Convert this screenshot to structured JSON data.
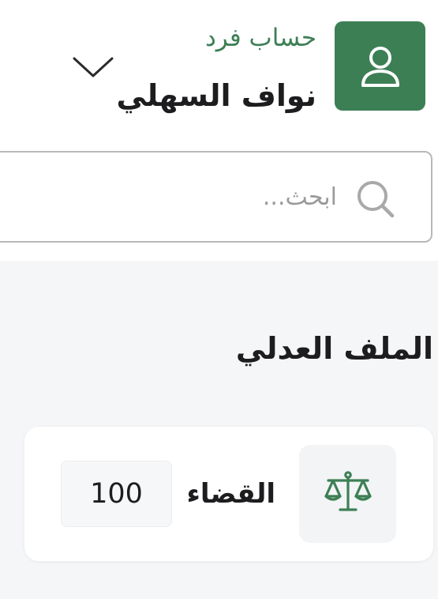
{
  "colors": {
    "accent": "#3d7f55",
    "text_primary": "#1d1d1f",
    "placeholder": "#9a9a9a",
    "background": "#f5f6f8"
  },
  "header": {
    "account_type": "حساب فرد",
    "user_name": "نواف السهلي",
    "avatar_icon": "user-icon",
    "dropdown_icon": "chevron-down-icon"
  },
  "search": {
    "placeholder": "ابحث...",
    "value": "",
    "icon": "search-icon"
  },
  "section": {
    "title": "الملف العدلي"
  },
  "card": {
    "icon": "scales-icon",
    "label": "القضاء",
    "value": "100"
  }
}
